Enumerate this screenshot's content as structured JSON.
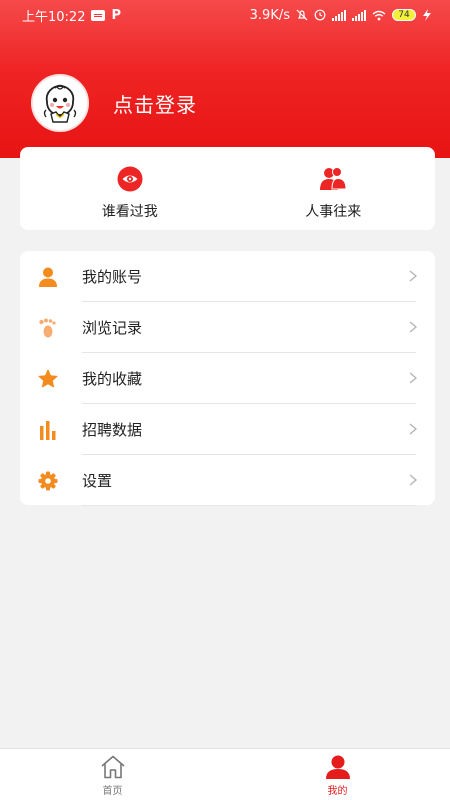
{
  "status_bar": {
    "time": "上午10:22",
    "net_speed": "3.9K/s",
    "battery": "74",
    "icons": [
      "message-icon",
      "p-icon",
      "alarm-off-icon",
      "clock-icon",
      "signal-icon",
      "signal-icon",
      "wifi-icon",
      "battery-icon",
      "charging-icon"
    ]
  },
  "profile": {
    "login_label": "点击登录",
    "avatar_icon": "mascot-avatar-icon"
  },
  "quick_actions": [
    {
      "label": "谁看过我",
      "icon": "eye-icon"
    },
    {
      "label": "人事往来",
      "icon": "users-icon"
    }
  ],
  "menu": [
    {
      "label": "我的账号",
      "icon": "person-icon"
    },
    {
      "label": "浏览记录",
      "icon": "footprint-icon"
    },
    {
      "label": "我的收藏",
      "icon": "star-icon"
    },
    {
      "label": "招聘数据",
      "icon": "bar-chart-icon"
    },
    {
      "label": "设置",
      "icon": "gear-icon"
    }
  ],
  "tabbar": [
    {
      "label": "首页",
      "icon": "home-icon",
      "active": false
    },
    {
      "label": "我的",
      "icon": "profile-icon",
      "active": true
    }
  ],
  "colors": {
    "brand_red": "#ef2323",
    "accent_orange": "#f38b1f",
    "tab_active": "#e51c1c"
  }
}
